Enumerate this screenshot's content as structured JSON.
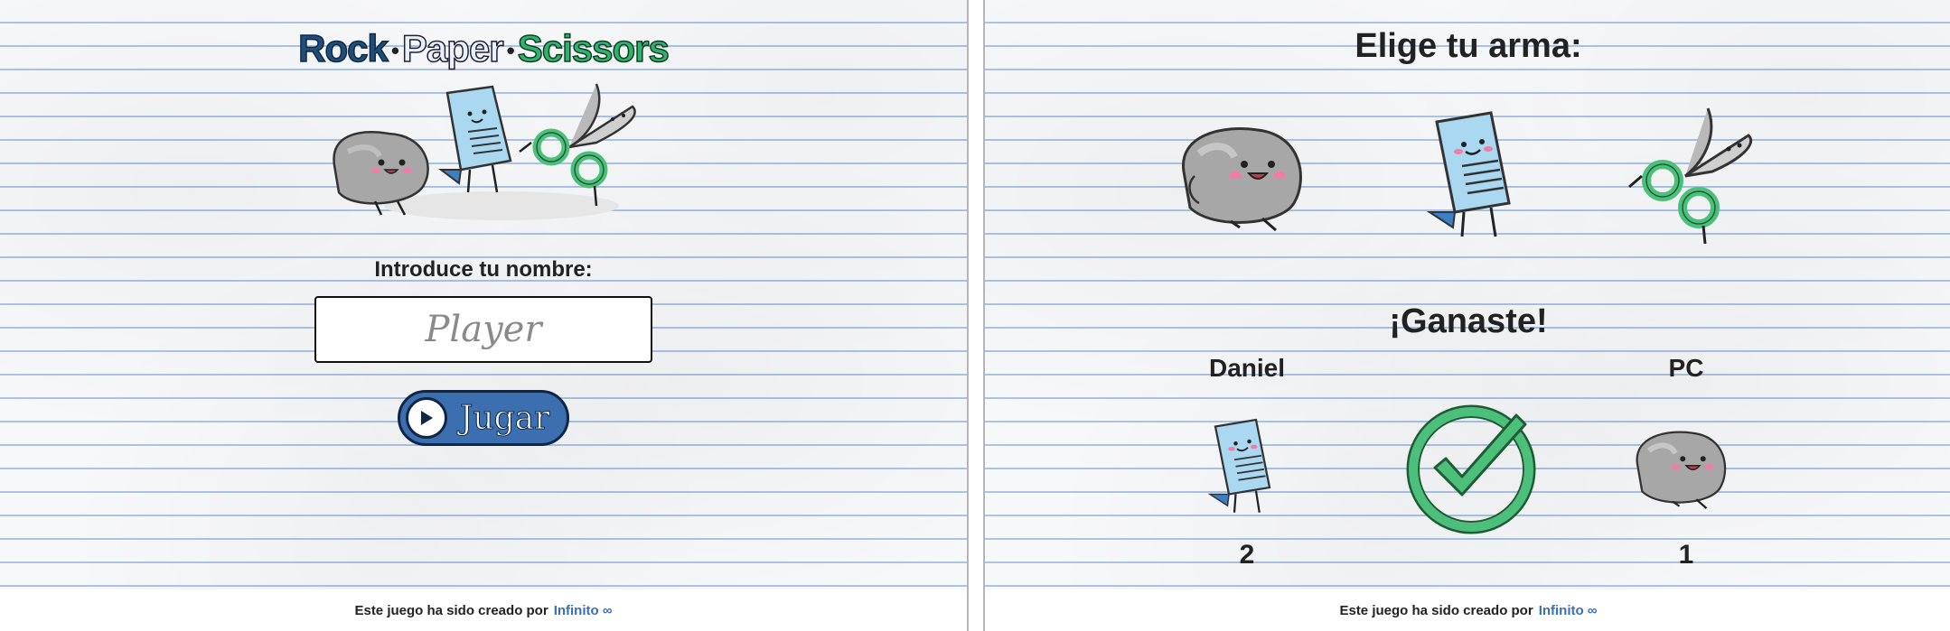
{
  "home": {
    "logo": {
      "rock": "Rock",
      "paper": "Paper",
      "scissors": "Scissors",
      "separator": "•"
    },
    "name_prompt": "Introduce tu nombre:",
    "name_input": {
      "value": "",
      "placeholder": "Player"
    },
    "play_button": {
      "label": "Jugar",
      "icon": "play-icon"
    },
    "footer": {
      "text": "Este juego ha sido creado por",
      "link": "Infinito ∞"
    }
  },
  "game": {
    "heading": "Elige tu arma:",
    "choices": [
      {
        "id": "rock",
        "icon": "rock-character-icon"
      },
      {
        "id": "paper",
        "icon": "paper-character-icon"
      },
      {
        "id": "scissors",
        "icon": "scissors-character-icon"
      }
    ],
    "result": "¡Ganaste!",
    "player": {
      "name": "Daniel",
      "pick": "paper",
      "score": "2"
    },
    "computer": {
      "name": "PC",
      "pick": "rock",
      "score": "1"
    },
    "result_icon": "check-circle-icon",
    "footer": {
      "text": "Este juego ha sido creado por",
      "link": "Infinito ∞"
    }
  },
  "colors": {
    "accent_blue": "#3b6fb0",
    "success_green": "#4cc07a",
    "rock_gray": "#a7a7a7",
    "paper_blue": "#a9d8f0",
    "ruled_line": "#a9c4e6"
  }
}
